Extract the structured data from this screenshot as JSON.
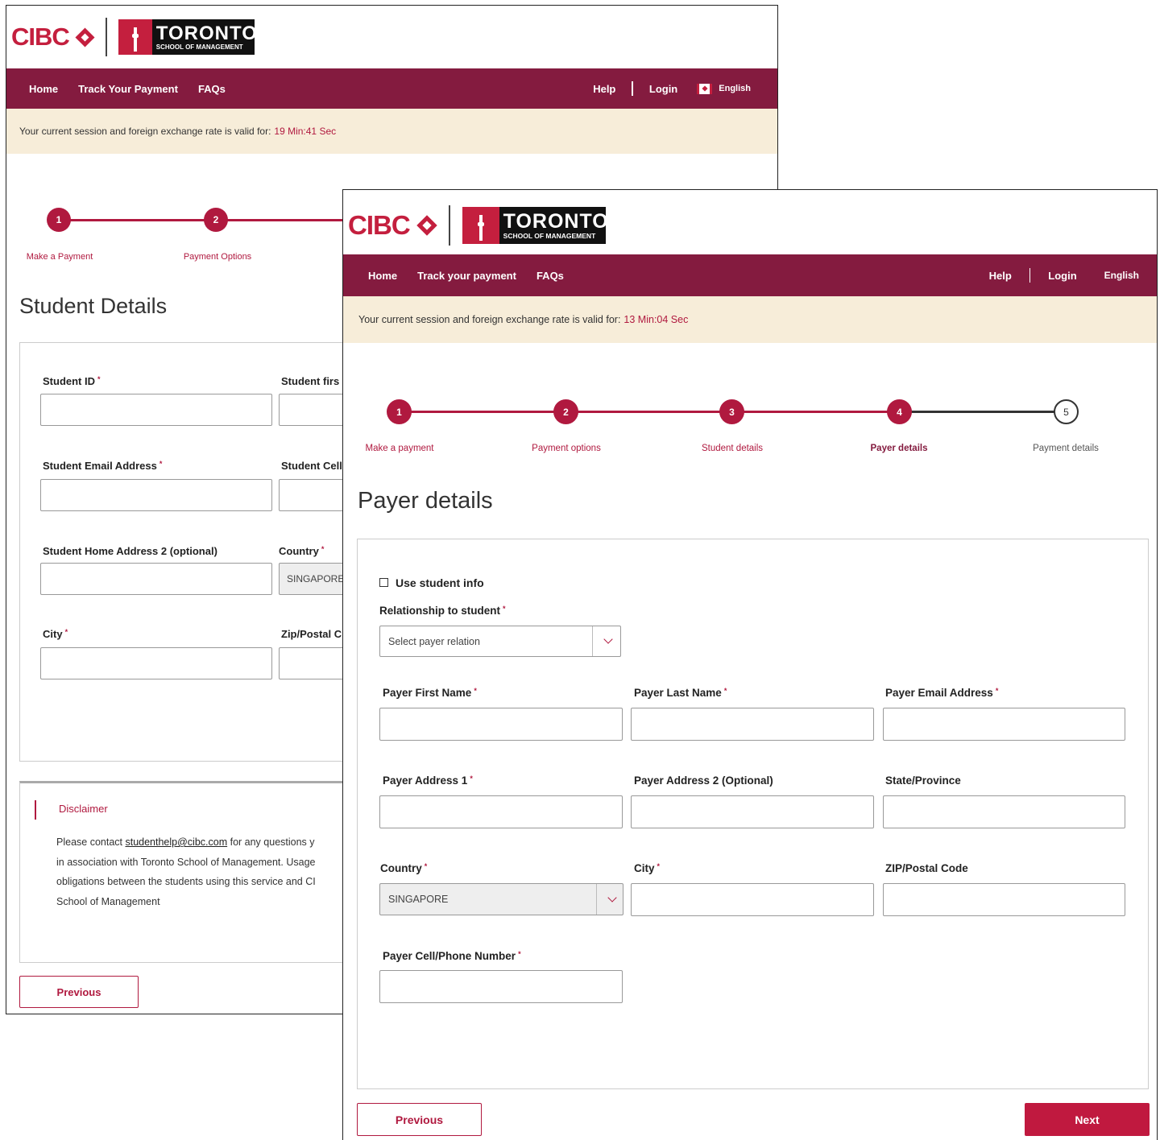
{
  "brand": {
    "cibc": "CIBC",
    "school_name": "TORONTO",
    "school_sub": "SCHOOL OF MANAGEMENT"
  },
  "back": {
    "nav": {
      "home": "Home",
      "track": "Track Your Payment",
      "faqs": "FAQs",
      "help": "Help",
      "login": "Login",
      "language": "English"
    },
    "session": {
      "text": "Your current session and foreign exchange rate is valid for:",
      "timer": "19 Min:41 Sec"
    },
    "steps": [
      {
        "num": "1",
        "label": "Make a Payment"
      },
      {
        "num": "2",
        "label": "Payment Options"
      }
    ],
    "title": "Student Details",
    "fields": {
      "student_id": "Student ID",
      "student_first": "Student firs",
      "email": "Student Email Address",
      "cell": "Student Cell",
      "address2": "Student Home Address 2 (optional)",
      "country": "Country",
      "country_value": "SINGAPORE",
      "city": "City",
      "zip": "Zip/Postal C"
    },
    "disclaimer": {
      "title": "Disclaimer",
      "lead": "Please contact ",
      "email": "studenthelp@cibc.com",
      "rest1": " for any questions y",
      "line2": "in association with Toronto School of Management. Usage",
      "line3": "obligations between the students using this service and CI",
      "line4": "School of Management"
    },
    "previous": "Previous"
  },
  "front": {
    "nav": {
      "home": "Home",
      "track": "Track your payment",
      "faqs": "FAQs",
      "help": "Help",
      "login": "Login",
      "language": "English"
    },
    "session": {
      "text": "Your current session and foreign exchange rate is valid for:",
      "timer": "13 Min:04 Sec"
    },
    "steps": [
      {
        "num": "1",
        "label": "Make a payment",
        "state": "done"
      },
      {
        "num": "2",
        "label": "Payment options",
        "state": "done"
      },
      {
        "num": "3",
        "label": "Student details",
        "state": "done"
      },
      {
        "num": "4",
        "label": "Payer details",
        "state": "active"
      },
      {
        "num": "5",
        "label": "Payment details",
        "state": "todo"
      }
    ],
    "title": "Payer details",
    "use_student_info": "Use student info",
    "relationship_label": "Relationship to student",
    "relationship_placeholder": "Select payer relation",
    "fields": {
      "first_name": "Payer First Name",
      "last_name": "Payer Last Name",
      "email": "Payer Email Address",
      "address1": "Payer Address 1",
      "address2": "Payer Address 2 (Optional)",
      "state": "State/Province",
      "country": "Country",
      "country_value": "SINGAPORE",
      "city": "City",
      "zip": "ZIP/Postal Code",
      "phone": "Payer Cell/Phone Number"
    },
    "previous": "Previous",
    "next": "Next"
  },
  "required_mark": "*",
  "colors": {
    "brand_red": "#c41f3e",
    "nav_maroon": "#841b3f",
    "session_bg": "#f7edd9"
  }
}
